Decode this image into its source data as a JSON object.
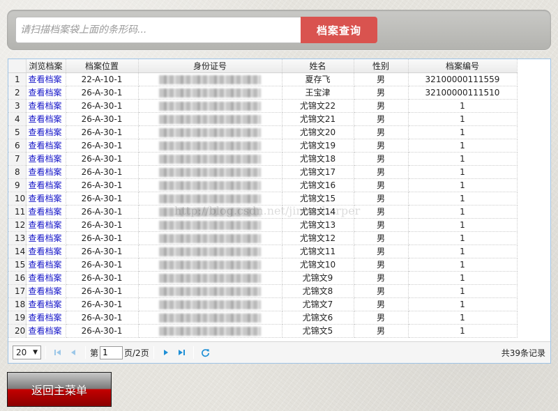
{
  "search": {
    "placeholder": "请扫描档案袋上面的条形码...",
    "button_label": "档案查询"
  },
  "grid": {
    "columns": [
      "",
      "浏览档案",
      "档案位置",
      "身份证号",
      "姓名",
      "性别",
      "档案编号"
    ],
    "link_text": "查看档案",
    "rows": [
      {
        "num": "1",
        "location": "22-A-10-1",
        "name": "夏存飞",
        "gender": "男",
        "archive_no": "32100000111559"
      },
      {
        "num": "2",
        "location": "26-A-30-1",
        "name": "王宝津",
        "gender": "男",
        "archive_no": "32100000111510"
      },
      {
        "num": "3",
        "location": "26-A-30-1",
        "name": "尤锦文22",
        "gender": "男",
        "archive_no": "1"
      },
      {
        "num": "4",
        "location": "26-A-30-1",
        "name": "尤锦文21",
        "gender": "男",
        "archive_no": "1"
      },
      {
        "num": "5",
        "location": "26-A-30-1",
        "name": "尤锦文20",
        "gender": "男",
        "archive_no": "1"
      },
      {
        "num": "6",
        "location": "26-A-30-1",
        "name": "尤锦文19",
        "gender": "男",
        "archive_no": "1"
      },
      {
        "num": "7",
        "location": "26-A-30-1",
        "name": "尤锦文18",
        "gender": "男",
        "archive_no": "1"
      },
      {
        "num": "8",
        "location": "26-A-30-1",
        "name": "尤锦文17",
        "gender": "男",
        "archive_no": "1"
      },
      {
        "num": "9",
        "location": "26-A-30-1",
        "name": "尤锦文16",
        "gender": "男",
        "archive_no": "1"
      },
      {
        "num": "10",
        "location": "26-A-30-1",
        "name": "尤锦文15",
        "gender": "男",
        "archive_no": "1"
      },
      {
        "num": "11",
        "location": "26-A-30-1",
        "name": "尤锦文14",
        "gender": "男",
        "archive_no": "1"
      },
      {
        "num": "12",
        "location": "26-A-30-1",
        "name": "尤锦文13",
        "gender": "男",
        "archive_no": "1"
      },
      {
        "num": "13",
        "location": "26-A-30-1",
        "name": "尤锦文12",
        "gender": "男",
        "archive_no": "1"
      },
      {
        "num": "14",
        "location": "26-A-30-1",
        "name": "尤锦文11",
        "gender": "男",
        "archive_no": "1"
      },
      {
        "num": "15",
        "location": "26-A-30-1",
        "name": "尤锦文10",
        "gender": "男",
        "archive_no": "1"
      },
      {
        "num": "16",
        "location": "26-A-30-1",
        "name": "尤锦文9",
        "gender": "男",
        "archive_no": "1"
      },
      {
        "num": "17",
        "location": "26-A-30-1",
        "name": "尤锦文8",
        "gender": "男",
        "archive_no": "1"
      },
      {
        "num": "18",
        "location": "26-A-30-1",
        "name": "尤锦文7",
        "gender": "男",
        "archive_no": "1"
      },
      {
        "num": "19",
        "location": "26-A-30-1",
        "name": "尤锦文6",
        "gender": "男",
        "archive_no": "1"
      },
      {
        "num": "20",
        "location": "26-A-30-1",
        "name": "尤锦文5",
        "gender": "男",
        "archive_no": "1"
      }
    ]
  },
  "watermark": "http://blog.csdn.net/jinacsharper",
  "pager": {
    "page_size": "20",
    "page_prefix": "第",
    "current_page": "1",
    "page_suffix": "页/2页",
    "total": "共39条记录"
  },
  "footer": {
    "return_label": "返回主菜单"
  },
  "colors": {
    "accent": "#d9534f",
    "link": "#1515c8",
    "grid_border": "#9ec3e6",
    "pager_icon": "#1e8fd6"
  },
  "icons": [
    "first-page-icon",
    "prev-page-icon",
    "next-page-icon",
    "last-page-icon",
    "refresh-icon",
    "dropdown-caret-icon"
  ]
}
